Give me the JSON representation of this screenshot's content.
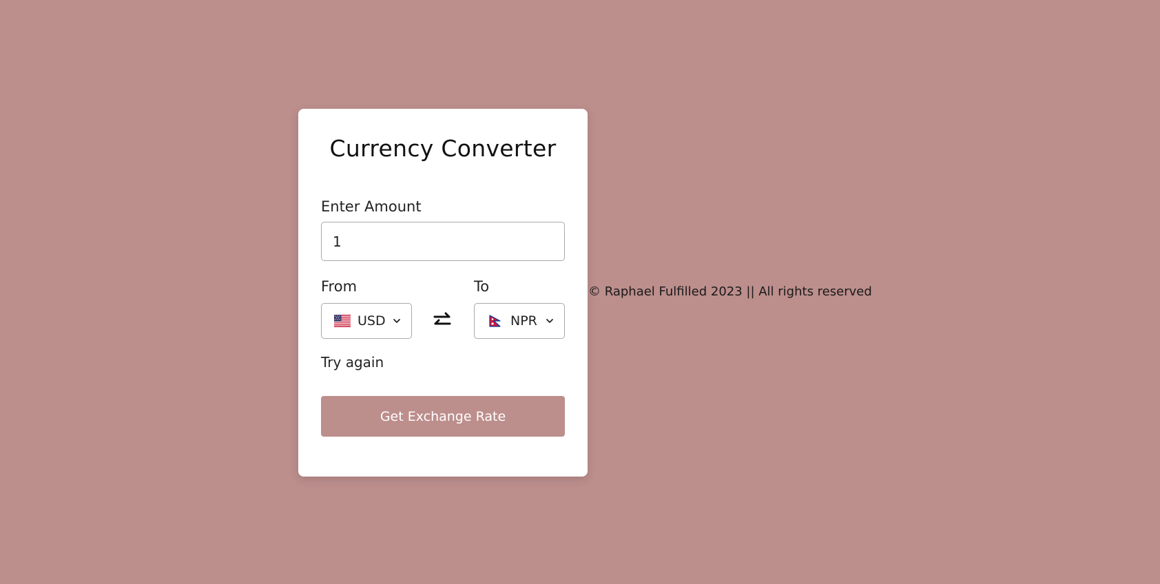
{
  "converter": {
    "title": "Currency Converter",
    "amount_label": "Enter Amount",
    "amount_value": "1",
    "from_label": "From",
    "to_label": "To",
    "from_currency": "USD",
    "to_currency": "NPR",
    "from_flag": "us-flag",
    "to_flag": "nepal-flag",
    "status_text": "Try again",
    "button_label": "Get Exchange Rate"
  },
  "footer": {
    "text": "© Raphael Fulfilled 2023 || All rights reserved"
  },
  "colors": {
    "background": "#bc8e8c",
    "card": "#ffffff",
    "button": "#bc8e8c",
    "button_text": "#ffffff"
  }
}
